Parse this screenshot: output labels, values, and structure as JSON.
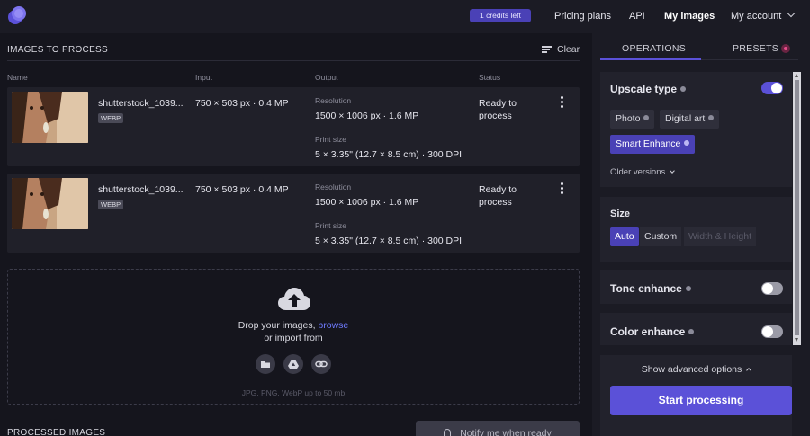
{
  "nav": {
    "credits": "1 credits left",
    "links": [
      "Pricing plans",
      "API",
      "My images"
    ],
    "account": "My account"
  },
  "images_section": {
    "title": "IMAGES TO PROCESS",
    "clear_label": "Clear",
    "columns": [
      "Name",
      "Input",
      "Output",
      "Status"
    ],
    "rows": [
      {
        "name": "shutterstock_1039...",
        "format": "WEBP",
        "input": "750 × 503 px · 0.4 MP",
        "resolution_label": "Resolution",
        "resolution": "1500 × 1006 px · 1.6 MP",
        "print_label": "Print size",
        "print": "5 × 3.35\" (12.7 × 8.5 cm) · 300 DPI",
        "status": "Ready to process"
      },
      {
        "name": "shutterstock_1039...",
        "format": "WEBP",
        "input": "750 × 503 px · 0.4 MP",
        "resolution_label": "Resolution",
        "resolution": "1500 × 1006 px · 1.6 MP",
        "print_label": "Print size",
        "print": "5 × 3.35\" (12.7 × 8.5 cm) · 300 DPI",
        "status": "Ready to process"
      }
    ]
  },
  "dropzone": {
    "text_prefix": "Drop your images, ",
    "browse": "browse",
    "text2": "or import from",
    "note": "JPG, PNG, WebP up to 50 mb",
    "icons": [
      "folder-icon",
      "google-drive-icon",
      "link-icon"
    ]
  },
  "processed": {
    "title": "PROCESSED IMAGES",
    "notify_label": "Notify me when ready"
  },
  "panel": {
    "tabs": [
      "OPERATIONS",
      "PRESETS"
    ],
    "upscale": {
      "title": "Upscale type",
      "enabled": true,
      "options": [
        "Photo",
        "Digital art",
        "Smart Enhance"
      ],
      "selected": "Smart Enhance",
      "older": "Older versions"
    },
    "size": {
      "title": "Size",
      "options": [
        "Auto",
        "Custom",
        "Width & Height"
      ],
      "selected": "Auto"
    },
    "tone": {
      "title": "Tone enhance",
      "enabled": false
    },
    "color": {
      "title": "Color enhance",
      "enabled": false
    },
    "advanced": "Show advanced options",
    "start": "Start processing"
  },
  "colors": {
    "accent": "#5b51d8",
    "link": "#6f7bff",
    "presets_dot": "#e84c8c"
  }
}
